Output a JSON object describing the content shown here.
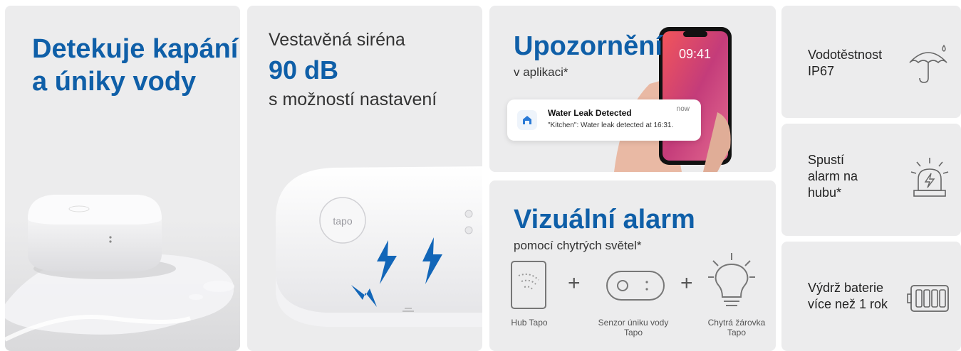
{
  "panel_leak": {
    "title": "Detekuje kapání a úniky vody"
  },
  "panel_siren": {
    "line1": "Vestavěná siréna",
    "line2": "90 dB",
    "line3": "s možností nastavení",
    "device_logo": "tapo"
  },
  "panel_notify": {
    "title": "Upozornění",
    "subtitle": "v aplikaci*",
    "phone_time": "09:41",
    "notification": {
      "title": "Water Leak Detected",
      "body": "\"Kitchen\": Water leak detected at 16:31.",
      "time": "now"
    }
  },
  "panel_visual": {
    "title": "Vizuální alarm",
    "subtitle": "pomocí chytrých světel*",
    "items": [
      {
        "label": "Hub Tapo",
        "icon": "hub-icon"
      },
      {
        "label": "Senzor úniku vody Tapo",
        "icon": "sensor-icon"
      },
      {
        "label": "Chytrá žárovka Tapo",
        "icon": "bulb-icon"
      }
    ]
  },
  "features": [
    {
      "text": "Vodotěstnost IP67",
      "icon": "umbrella-icon"
    },
    {
      "text": "Spustí alarm na hubu*",
      "icon": "siren-icon"
    },
    {
      "text": "Výdrž baterie více než 1 rok",
      "icon": "battery-icon"
    }
  ],
  "colors": {
    "accent": "#0f5fa8",
    "card": "#ececed"
  }
}
